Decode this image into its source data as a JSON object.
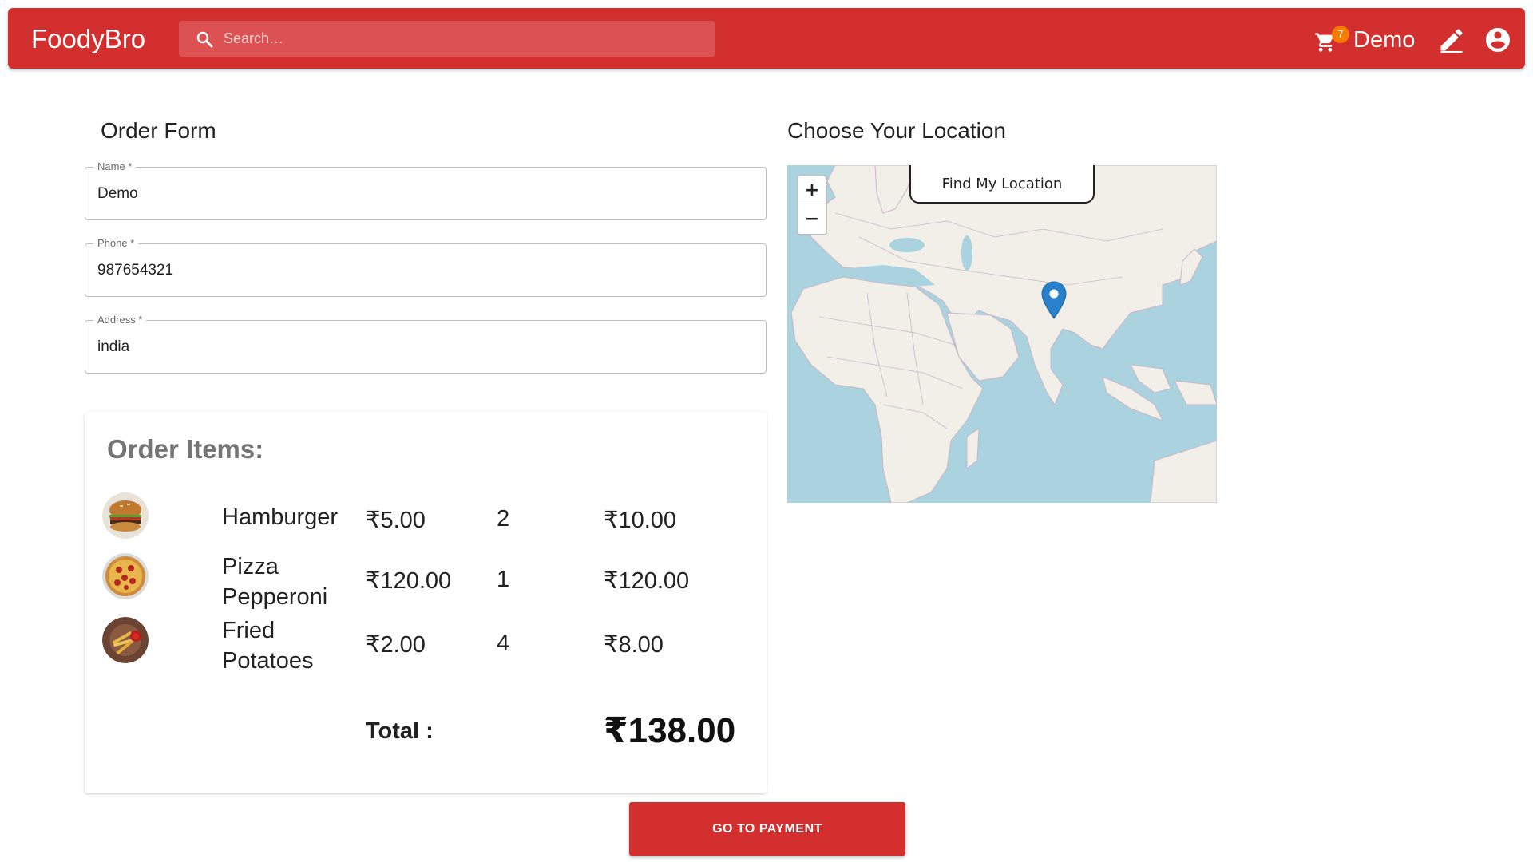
{
  "app": {
    "brand": "FoodyBro",
    "search_placeholder": "Search…",
    "cart_count": "7",
    "user_name": "Demo",
    "icons": {
      "search": "search-icon",
      "cart": "cart-icon",
      "edit": "edit-icon",
      "account": "account-icon"
    }
  },
  "order_form": {
    "title": "Order Form",
    "fields": {
      "name": {
        "label": "Name *",
        "value": "Demo"
      },
      "phone": {
        "label": "Phone *",
        "value": "987654321"
      },
      "address": {
        "label": "Address *",
        "value": "india"
      }
    }
  },
  "order_items": {
    "title": "Order Items:",
    "items": [
      {
        "name": "Hamburger",
        "price": "₹5.00",
        "qty": "2",
        "total": "₹10.00",
        "image": "hamburger-image"
      },
      {
        "name": "Pizza Pepperoni",
        "price": "₹120.00",
        "qty": "1",
        "total": "₹120.00",
        "image": "pizza-image"
      },
      {
        "name": "Fried Potatoes",
        "price": "₹2.00",
        "qty": "4",
        "total": "₹8.00",
        "image": "fries-image"
      }
    ],
    "total_label": "Total :",
    "total_value": "₹138.00"
  },
  "location": {
    "title": "Choose Your Location",
    "find_button": "Find My Location",
    "zoom_in": "+",
    "zoom_out": "−"
  },
  "actions": {
    "pay_button": "GO TO PAYMENT"
  },
  "colors": {
    "primary": "#d32f2f",
    "badge": "#f57c00",
    "water": "#aad3df",
    "land": "#f2efe9",
    "marker": "#2a81cb"
  }
}
